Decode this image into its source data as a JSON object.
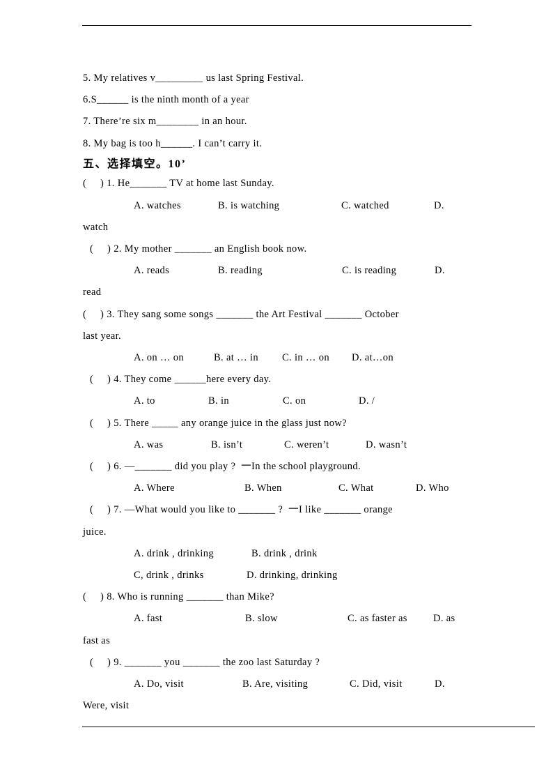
{
  "fill_in": [
    {
      "text": "5. My relatives v_________ us last Spring Festival."
    },
    {
      "text": "6.S______ is the ninth month of a year"
    },
    {
      "text": "7. There’re six m________ in an hour."
    },
    {
      "text": "8. My bag is too h______. I can’t carry it."
    }
  ],
  "section": {
    "title": "五、选择填空。10’"
  },
  "questions": [
    {
      "stem": "(     ) 1. He_______ TV at home last Sunday.",
      "options": [
        "A. watches",
        "B. is watching",
        "C. watched",
        "D."
      ],
      "wrap": "watch"
    },
    {
      "stem": "(     ) 2. My mother _______ an English book now.",
      "options": [
        "A. reads",
        "B. reading",
        "C. is reading",
        "D."
      ],
      "wrap": "read"
    },
    {
      "stem": "(     ) 3. They sang some songs _______ the Art Festival _______ October",
      "wrap_stem": "last year.",
      "options": [
        "A. on … on",
        "B. at … in",
        "C. in … on",
        "D. at…on"
      ]
    },
    {
      "stem": "(     ) 4. They come ______here every day.",
      "options": [
        "A. to",
        "B. in",
        "C. on",
        "D. /"
      ]
    },
    {
      "stem": "(     ) 5. There _____ any orange juice in the glass just now?",
      "options": [
        "A. was",
        "B. isn’t",
        "C. weren’t",
        "D. wasn’t"
      ]
    },
    {
      "stem": "(     ) 6. —_______ did you play ?  一In the school playground.",
      "options": [
        "A. Where",
        "B. When",
        "C. What",
        "D. Who"
      ]
    },
    {
      "stem": "(     ) 7. —What would you like to _______ ?  一I like _______ orange",
      "wrap_stem": "juice.",
      "options": [
        "A. drink , drinking",
        "B. drink , drink",
        "C, drink , drinks",
        "D. drinking, drinking"
      ]
    },
    {
      "stem": "(     ) 8. Who is running _______ than Mike?",
      "options": [
        "A. fast",
        "B. slow",
        "C. as faster as",
        "D. as"
      ],
      "wrap": "fast as"
    },
    {
      "stem": "(     ) 9. _______ you _______ the zoo last Saturday ?",
      "options": [
        "A. Do, visit",
        "B. Are, visiting",
        "C. Did, visit",
        "D."
      ],
      "wrap": "Were, visit"
    }
  ]
}
